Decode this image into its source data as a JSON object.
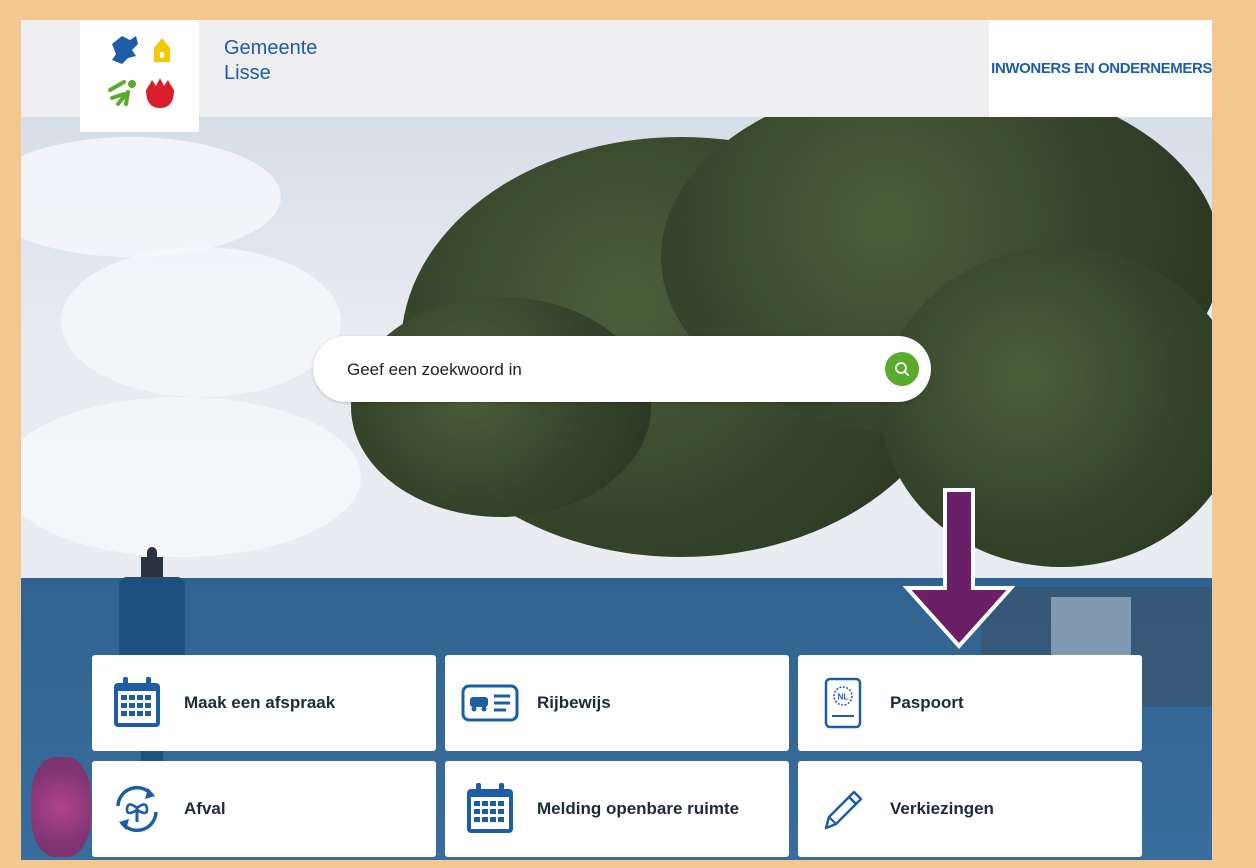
{
  "header": {
    "site_name_line1": "Gemeente",
    "site_name_line2": "Lisse",
    "nav_label": "INWONERS EN ONDERNEMERS"
  },
  "search": {
    "placeholder": "Geef een zoekwoord in",
    "button_icon": "search-icon"
  },
  "tiles": [
    {
      "label": "Maak een afspraak",
      "icon": "calendar-icon"
    },
    {
      "label": "Rijbewijs",
      "icon": "drivers-license-icon"
    },
    {
      "label": "Paspoort",
      "icon": "passport-icon"
    },
    {
      "label": "Afval",
      "icon": "recycle-icon"
    },
    {
      "label": "Melding openbare ruimte",
      "icon": "calendar-icon"
    },
    {
      "label": "Verkiezingen",
      "icon": "pencil-icon"
    }
  ],
  "colors": {
    "brand_blue": "#1c5da6",
    "search_green": "#5aaa2e",
    "annotation_purple": "#6b1f66",
    "border_orange": "#f4c690"
  }
}
